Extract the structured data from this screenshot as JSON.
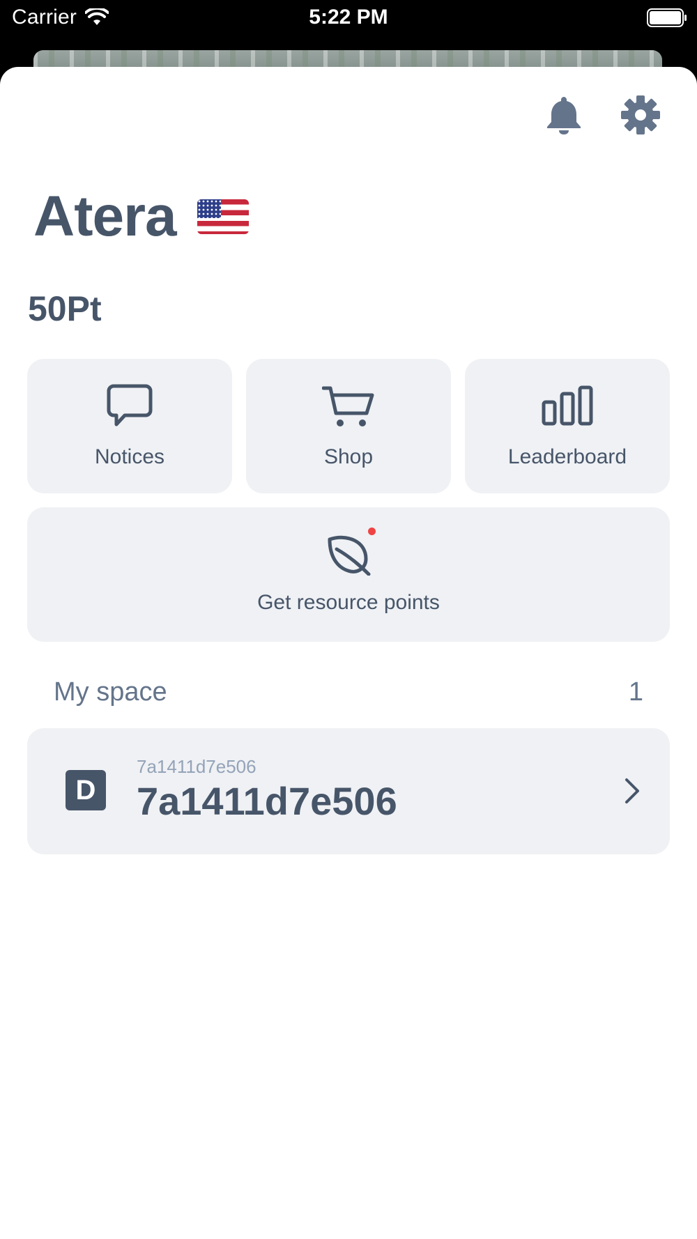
{
  "status_bar": {
    "carrier": "Carrier",
    "time": "5:22 PM"
  },
  "header": {
    "bell_icon": "bell-icon",
    "settings_icon": "gear-icon"
  },
  "profile": {
    "name": "Atera",
    "flag": "us-flag-icon",
    "points": "50Pt"
  },
  "tiles": [
    {
      "label": "Notices",
      "icon": "chat-bubble-icon"
    },
    {
      "label": "Shop",
      "icon": "cart-icon"
    },
    {
      "label": "Leaderboard",
      "icon": "bar-chart-icon"
    }
  ],
  "resource": {
    "label": "Get resource points",
    "icon": "leaf-icon",
    "notification_color": "#ef4444"
  },
  "my_space": {
    "title": "My space",
    "count": "1",
    "items": [
      {
        "badge": "D",
        "subtitle": "7a1411d7e506",
        "name": "7a1411d7e506"
      }
    ]
  },
  "colors": {
    "text": "#475569",
    "tile_bg": "#eff1f4",
    "muted": "#64748b"
  }
}
